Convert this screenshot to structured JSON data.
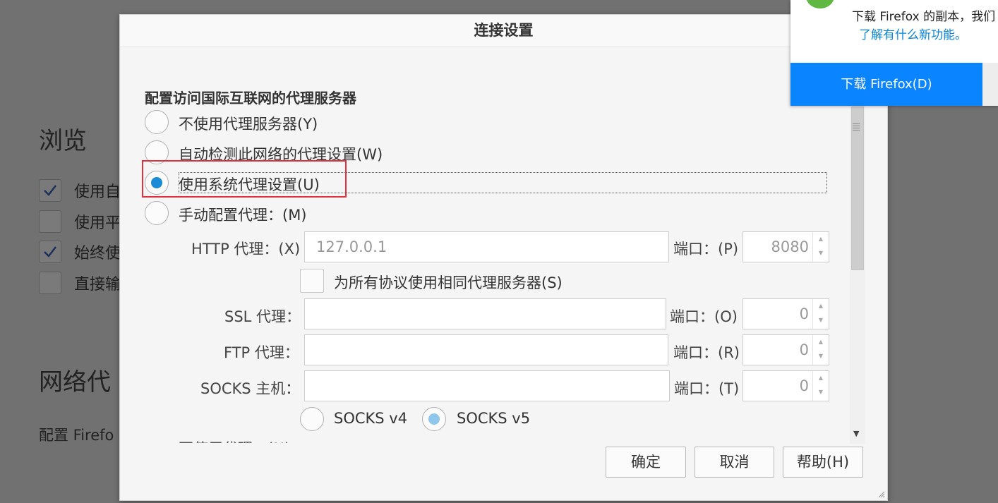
{
  "background": {
    "browse_heading": "浏览",
    "checkboxes": [
      {
        "label": "使用自",
        "checked": true
      },
      {
        "label": "使用平",
        "checked": false
      },
      {
        "label": "始终使",
        "checked": true
      },
      {
        "label": "直接输",
        "checked": false
      }
    ],
    "network_heading": "网络代",
    "network_desc": "配置 Firefo"
  },
  "notification": {
    "text": "下载 Firefox 的副本，我们",
    "link": "了解有什么新功能。",
    "button": "下载 Firefox(D)"
  },
  "dialog": {
    "title": "连接设置",
    "section_title": "配置访问国际互联网的代理服务器",
    "options": {
      "no_proxy": "不使用代理服务器(Y)",
      "auto_detect": "自动检测此网络的代理设置(W)",
      "system": "使用系统代理设置(U)",
      "manual": "手动配置代理：(M)"
    },
    "selected_option": "system",
    "http": {
      "label": "HTTP 代理：(X)",
      "value": "127.0.0.1",
      "port_label": "端口：(P)",
      "port": "8080"
    },
    "same_proxy_label": "为所有协议使用相同代理服务器(S)",
    "ssl": {
      "label": "SSL 代理：",
      "value": "",
      "port_label": "端口：(O)",
      "port": "0"
    },
    "ftp": {
      "label": "FTP 代理：",
      "value": "",
      "port_label": "端口：(R)",
      "port": "0"
    },
    "socks": {
      "label": "SOCKS 主机：",
      "value": "",
      "port_label": "端口：(T)",
      "port": "0"
    },
    "socks_v4": "SOCKS v4",
    "socks_v5": "SOCKS v5",
    "no_proxy_for_cut": "不使用代理：(N)",
    "buttons": {
      "ok": "确定",
      "cancel": "取消",
      "help": "帮助(H)"
    }
  },
  "colors": {
    "accent": "#0a84ff",
    "radio_selected": "#1a8bd6",
    "highlight_box": "#e0303a"
  }
}
